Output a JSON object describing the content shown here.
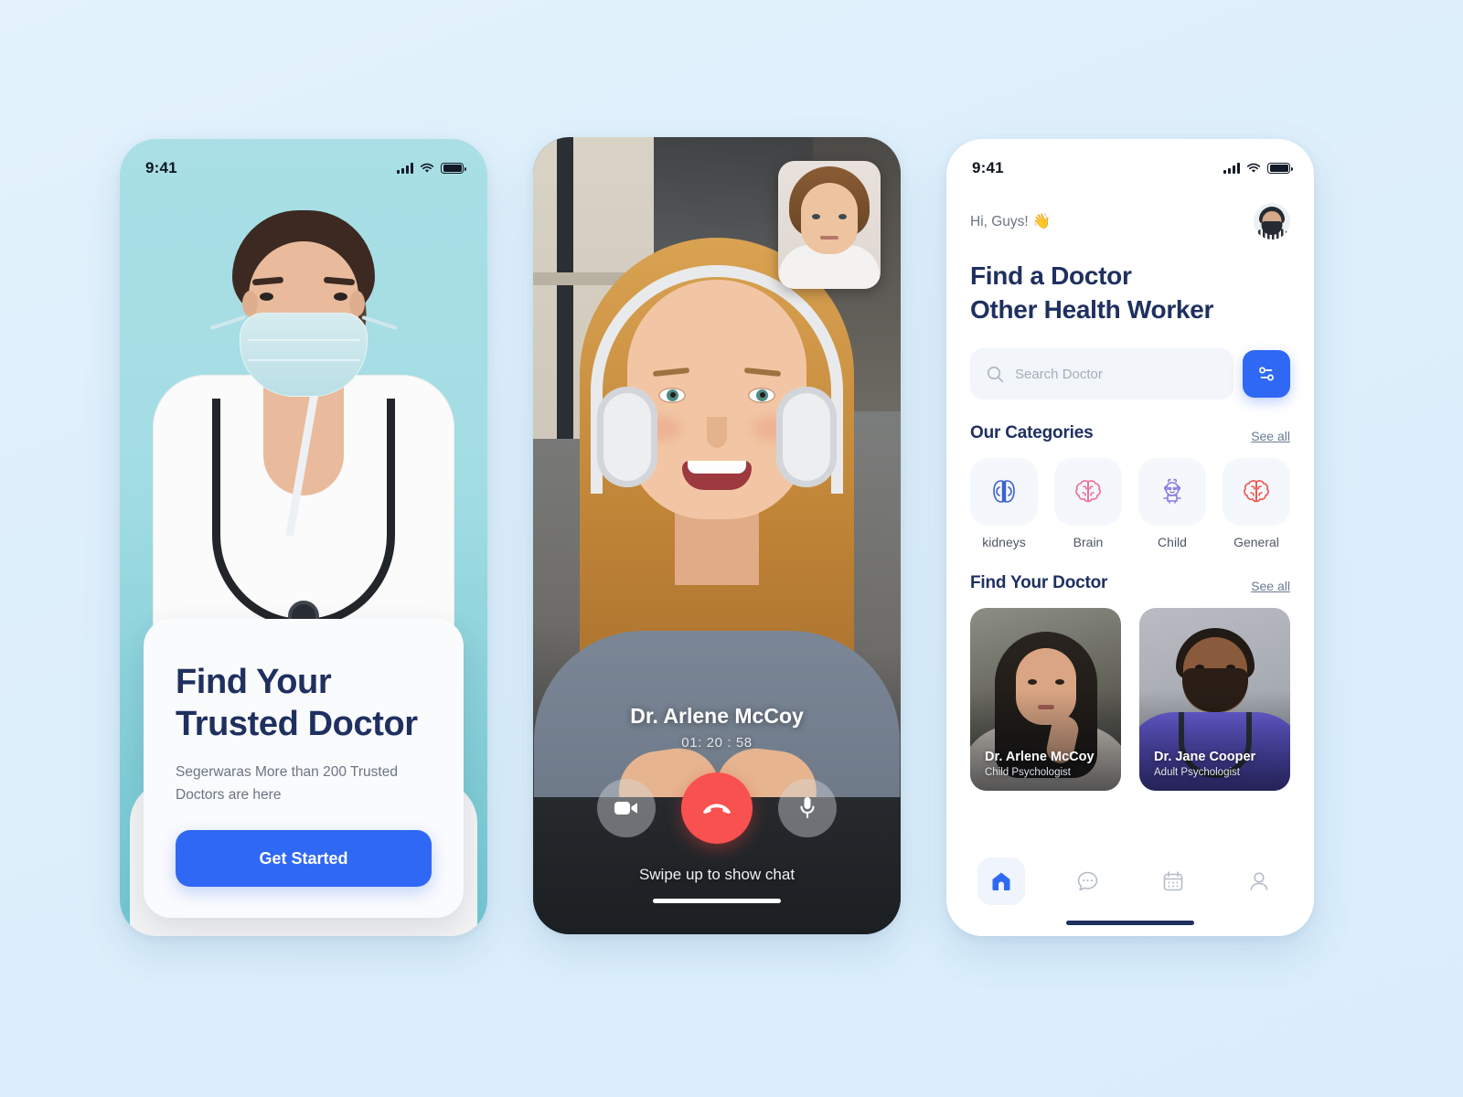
{
  "theme": {
    "page_background": "#dff0fc",
    "accent_blue": "#2f68f4",
    "navy": "#1f3060",
    "muted": "#6b7484",
    "danger_red": "#f9514f",
    "kidney_icon_color": "#3a5fd0",
    "brain_icon_color": "#ef6f96",
    "child_icon_color": "#8a7ae0",
    "general_icon_color": "#ef5350"
  },
  "screens": {
    "onboarding": {
      "name": "onboarding-screen",
      "status_bar": {
        "time": "9:41",
        "signal_icon": "signal-bars-icon",
        "wifi_icon": "wifi-icon",
        "battery_icon": "battery-full-icon"
      },
      "card": {
        "title_line_1": "Find Your",
        "title_line_2": "Trusted Doctor",
        "subtitle": "Segerwaras More than 200 Trusted Doctors are here",
        "cta_label": "Get Started"
      }
    },
    "video_call": {
      "name": "video-call-screen",
      "caller_name": "Dr. Arlene McCoy",
      "call_duration": "01: 20 : 58",
      "swipe_hint": "Swipe up to show chat",
      "controls": [
        {
          "name": "toggle-video-button",
          "icon": "video-camera-icon"
        },
        {
          "name": "end-call-button",
          "icon": "phone-hangup-icon"
        },
        {
          "name": "toggle-mic-button",
          "icon": "microphone-icon"
        }
      ],
      "pip_label": "self-view-thumbnail"
    },
    "home": {
      "name": "home-screen",
      "status_bar": {
        "time": "9:41",
        "signal_icon": "signal-bars-icon",
        "wifi_icon": "wifi-icon",
        "battery_icon": "battery-full-icon"
      },
      "greeting": "Hi, Guys!",
      "greeting_emoji": "👋",
      "avatar_label": "user-avatar",
      "title_line_1": "Find a Doctor",
      "title_line_2": "Other Health Worker",
      "search": {
        "placeholder": "Search Doctor",
        "value": "",
        "icon": "search-icon"
      },
      "filter_button": {
        "icon": "filter-sliders-icon"
      },
      "categories_section": {
        "title": "Our Categories",
        "see_all": "See all",
        "items": [
          {
            "label": "kidneys",
            "icon": "kidneys-icon"
          },
          {
            "label": "Brain",
            "icon": "brain-icon"
          },
          {
            "label": "Child",
            "icon": "child-icon"
          },
          {
            "label": "General",
            "icon": "brain-general-icon"
          }
        ]
      },
      "doctors_section": {
        "title": "Find Your Doctor",
        "see_all": "See all",
        "items": [
          {
            "name": "Dr. Arlene McCoy",
            "role": "Child Psychologist"
          },
          {
            "name": "Dr. Jane Cooper",
            "role": "Adult Psychologist"
          }
        ]
      },
      "tabbar": [
        {
          "name": "tab-home",
          "icon": "home-icon",
          "active": true
        },
        {
          "name": "tab-chat",
          "icon": "chat-bubble-icon",
          "active": false
        },
        {
          "name": "tab-calendar",
          "icon": "calendar-icon",
          "active": false
        },
        {
          "name": "tab-profile",
          "icon": "person-icon",
          "active": false
        }
      ]
    }
  }
}
